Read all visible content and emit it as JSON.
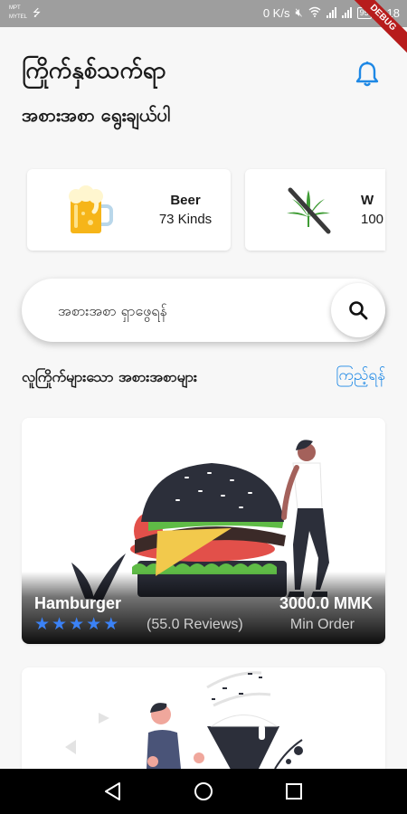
{
  "status_bar": {
    "carrier_1": "MPT",
    "carrier_2": "MYTEL",
    "speed": "0 K/s",
    "battery": "95",
    "time": "3:18",
    "debug_banner": "DEBUG"
  },
  "header": {
    "title": "ကြိုက်နှစ်သက်ရာ",
    "subtitle": "အစားအစာ ရွေးချယ်ပါ",
    "bell_icon": "notification-bell-icon",
    "accent_color": "#1e88e5"
  },
  "categories": [
    {
      "name": "Beer",
      "count": "73 Kinds",
      "icon": "beer-mug-icon"
    },
    {
      "name": "W",
      "count": "100",
      "icon": "no-cannabis-icon"
    }
  ],
  "search": {
    "placeholder": "အစားအစာ ရှာဖွေရန်",
    "icon": "search-icon"
  },
  "section": {
    "title": "လူကြိုက်များသော အစားအစာများ",
    "link": "ကြည့်ရန်"
  },
  "popular_foods": [
    {
      "name": "Hamburger",
      "rating": 5,
      "stars": "★★★★★",
      "reviews": "(55.0 Reviews)",
      "price": "3000.0 MMK",
      "price_caption": "Min Order"
    }
  ],
  "colors": {
    "star": "#3b82f6",
    "link": "#1e88e5"
  }
}
